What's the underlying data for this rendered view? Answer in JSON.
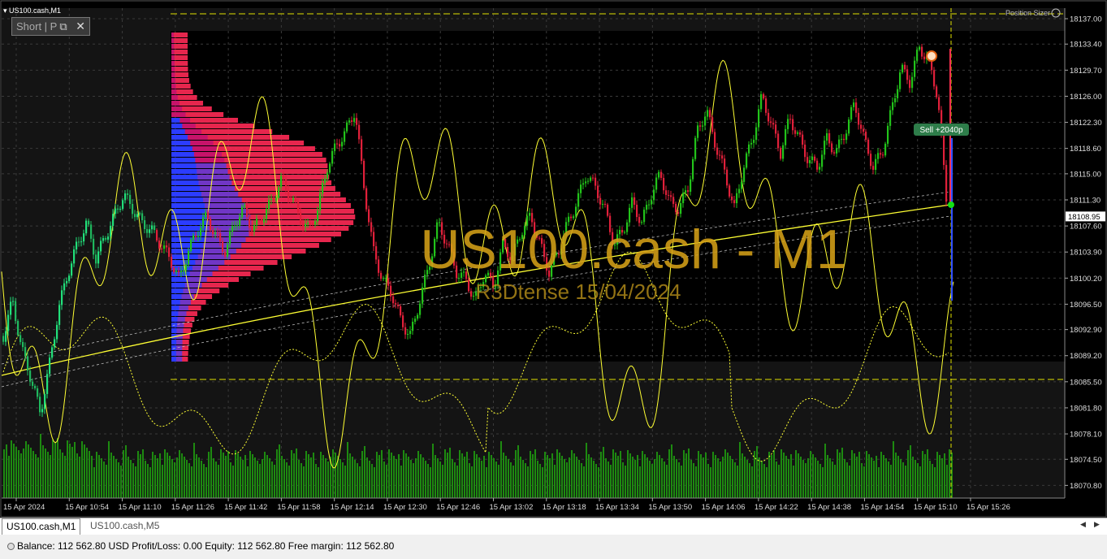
{
  "window": {
    "title": "US100.cash,M1"
  },
  "panel": {
    "short_label": "Short | P",
    "close_glyph": "✕"
  },
  "indicator": {
    "position_sizer": "Position Sizer"
  },
  "watermark": {
    "symbol": "US100.cash - M1",
    "subtitle": "R3Dtense 15/04/2024"
  },
  "trade": {
    "label": "Sell +2040p"
  },
  "chart_data": {
    "type": "candlestick",
    "symbol": "US100.cash",
    "timeframe": "M1",
    "current_price": "18108.95",
    "y_ticks": [
      "18137.00",
      "18133.40",
      "18129.70",
      "18126.00",
      "18122.30",
      "18118.60",
      "18115.00",
      "18111.30",
      "18107.60",
      "18103.90",
      "18100.20",
      "18096.50",
      "18092.90",
      "18089.20",
      "18085.50",
      "18081.80",
      "18078.10",
      "18074.50",
      "18070.80"
    ],
    "x_ticks": [
      "15 Apr 2024",
      "15 Apr 10:54",
      "15 Apr 11:10",
      "15 Apr 11:26",
      "15 Apr 11:42",
      "15 Apr 11:58",
      "15 Apr 12:14",
      "15 Apr 12:30",
      "15 Apr 12:46",
      "15 Apr 13:02",
      "15 Apr 13:18",
      "15 Apr 13:34",
      "15 Apr 13:50",
      "15 Apr 14:06",
      "15 Apr 14:22",
      "15 Apr 14:38",
      "15 Apr 14:54",
      "15 Apr 15:10",
      "15 Apr 15:26"
    ],
    "ylim": [
      18069.0,
      18138.5
    ],
    "close_path": [
      18092,
      18097,
      18090,
      18086,
      18081,
      18088,
      18096,
      18101,
      18105,
      18108,
      18103,
      18106,
      18109,
      18112,
      18110,
      18108,
      18107,
      18105,
      18103,
      18100,
      18104,
      18107,
      18109,
      18106,
      18104,
      18108,
      18110,
      18107,
      18109,
      18111,
      18114,
      18112,
      18109,
      18107,
      18110,
      18116,
      18119,
      18121,
      18124,
      18113,
      18104,
      18100,
      18098,
      18094,
      18092,
      18097,
      18102,
      18108,
      18105,
      18101,
      18100,
      18097,
      18101,
      18099,
      18105,
      18103,
      18107,
      18109,
      18105,
      18101,
      18104,
      18108,
      18111,
      18115,
      18113,
      18110,
      18105,
      18107,
      18111,
      18108,
      18112,
      18115,
      18111,
      18110,
      18113,
      18121,
      18124,
      18119,
      18115,
      18110,
      18116,
      18120,
      18126,
      18122,
      18118,
      18123,
      18120,
      18117,
      18116,
      18120,
      18118,
      18121,
      18125,
      18120,
      18116,
      18118,
      18124,
      18130,
      18128,
      18133,
      18131,
      18126,
      18110
    ],
    "colors": {
      "bull": "#22c31a",
      "bear": "#e0203a",
      "ma": "#ffff33",
      "volume": "#1d8a10",
      "profile_top": "#ff2a55",
      "profile_bottom": "#2b3cff"
    }
  },
  "tabs": [
    {
      "label": "US100.cash,M1",
      "active": true
    },
    {
      "label": "US100.cash,M5",
      "active": false
    }
  ],
  "status": {
    "text": "Balance: 112 562.80 USD   Profit/Loss: 0.00   Equity: 112 562.80   Free margin: 112 562.80"
  }
}
